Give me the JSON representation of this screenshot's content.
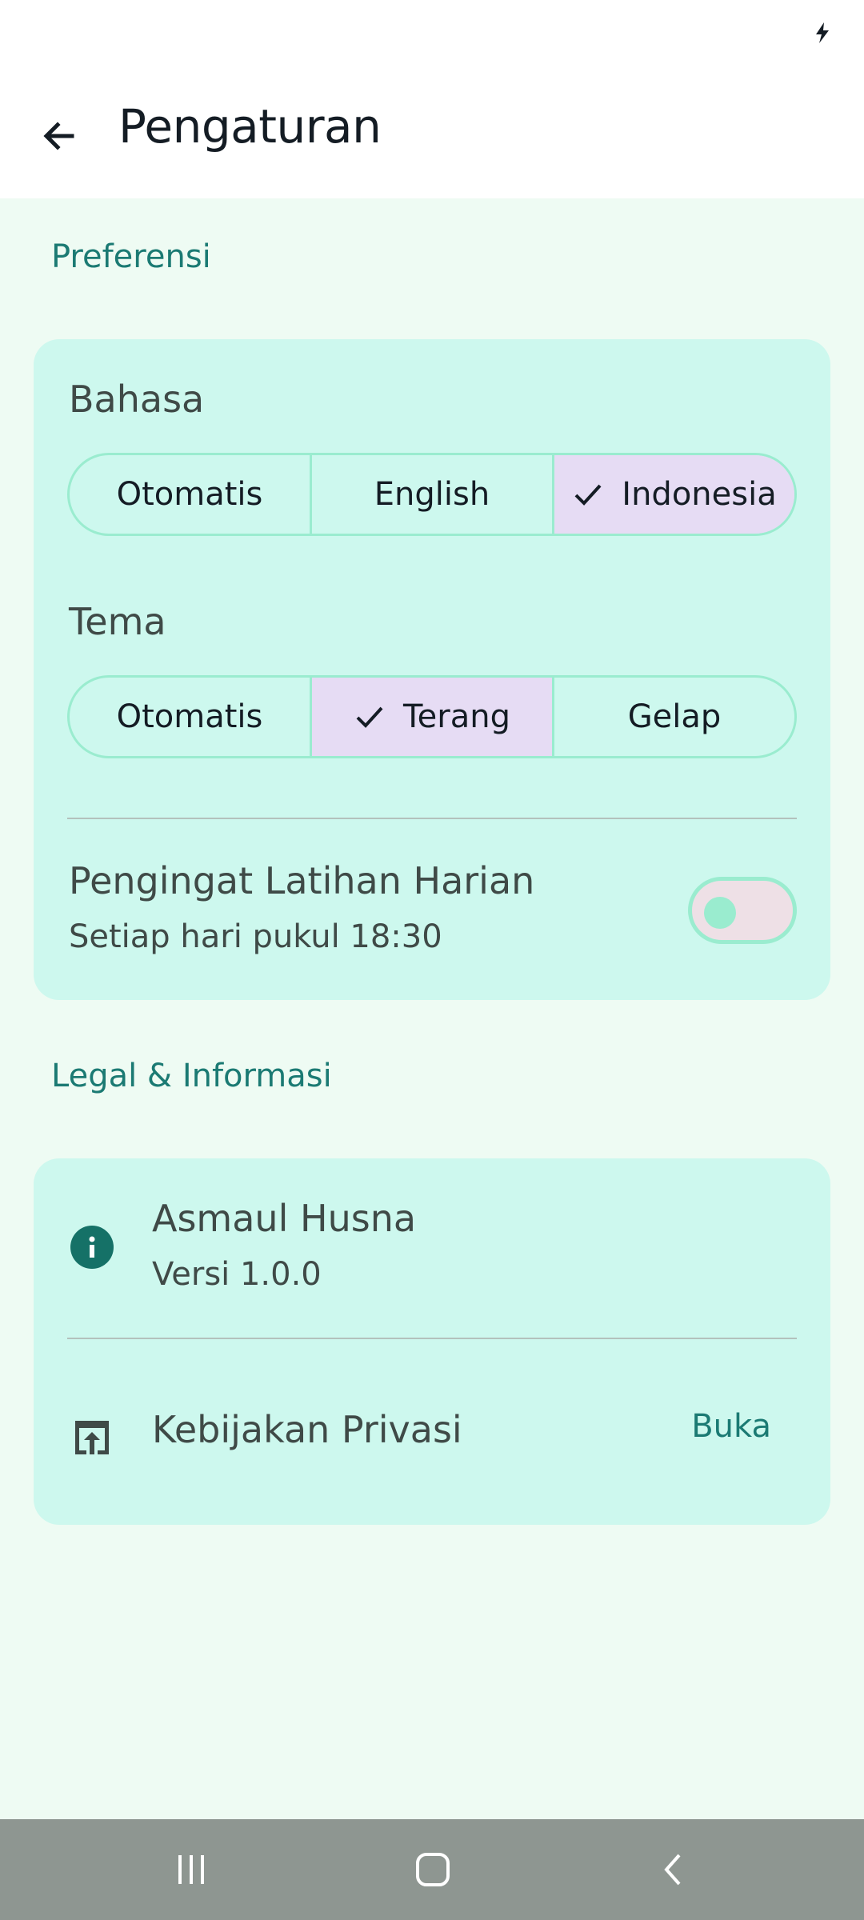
{
  "status_bar": {
    "icons": [
      "charging-bolt-icon"
    ]
  },
  "app_bar": {
    "title": "Pengaturan",
    "back_icon": "arrow-back-icon"
  },
  "sections": {
    "preferences": {
      "header": "Preferensi",
      "language": {
        "label": "Bahasa",
        "options": [
          "Otomatis",
          "English",
          "Indonesia"
        ],
        "selected": "Indonesia"
      },
      "theme": {
        "label": "Tema",
        "options": [
          "Otomatis",
          "Terang",
          "Gelap"
        ],
        "selected": "Terang"
      },
      "reminder": {
        "title": "Pengingat Latihan Harian",
        "subtitle": "Setiap hari pukul 18:30",
        "enabled": false
      }
    },
    "legal": {
      "header": "Legal & Informasi",
      "app_info": {
        "name": "Asmaul Husna",
        "version": "Versi 1.0.0",
        "icon": "info-icon"
      },
      "privacy": {
        "label": "Kebijakan Privasi",
        "action": "Buka",
        "icon": "open-in-browser-icon"
      }
    }
  },
  "colors": {
    "accent": "#1b7a73",
    "card": "#cdf8ee",
    "background": "#eefbf3",
    "selected_segment": "#e6dcf4",
    "outline": "#9aeccf"
  },
  "nav_bar": {
    "buttons": [
      "recent-apps-icon",
      "home-icon",
      "back-icon"
    ]
  }
}
